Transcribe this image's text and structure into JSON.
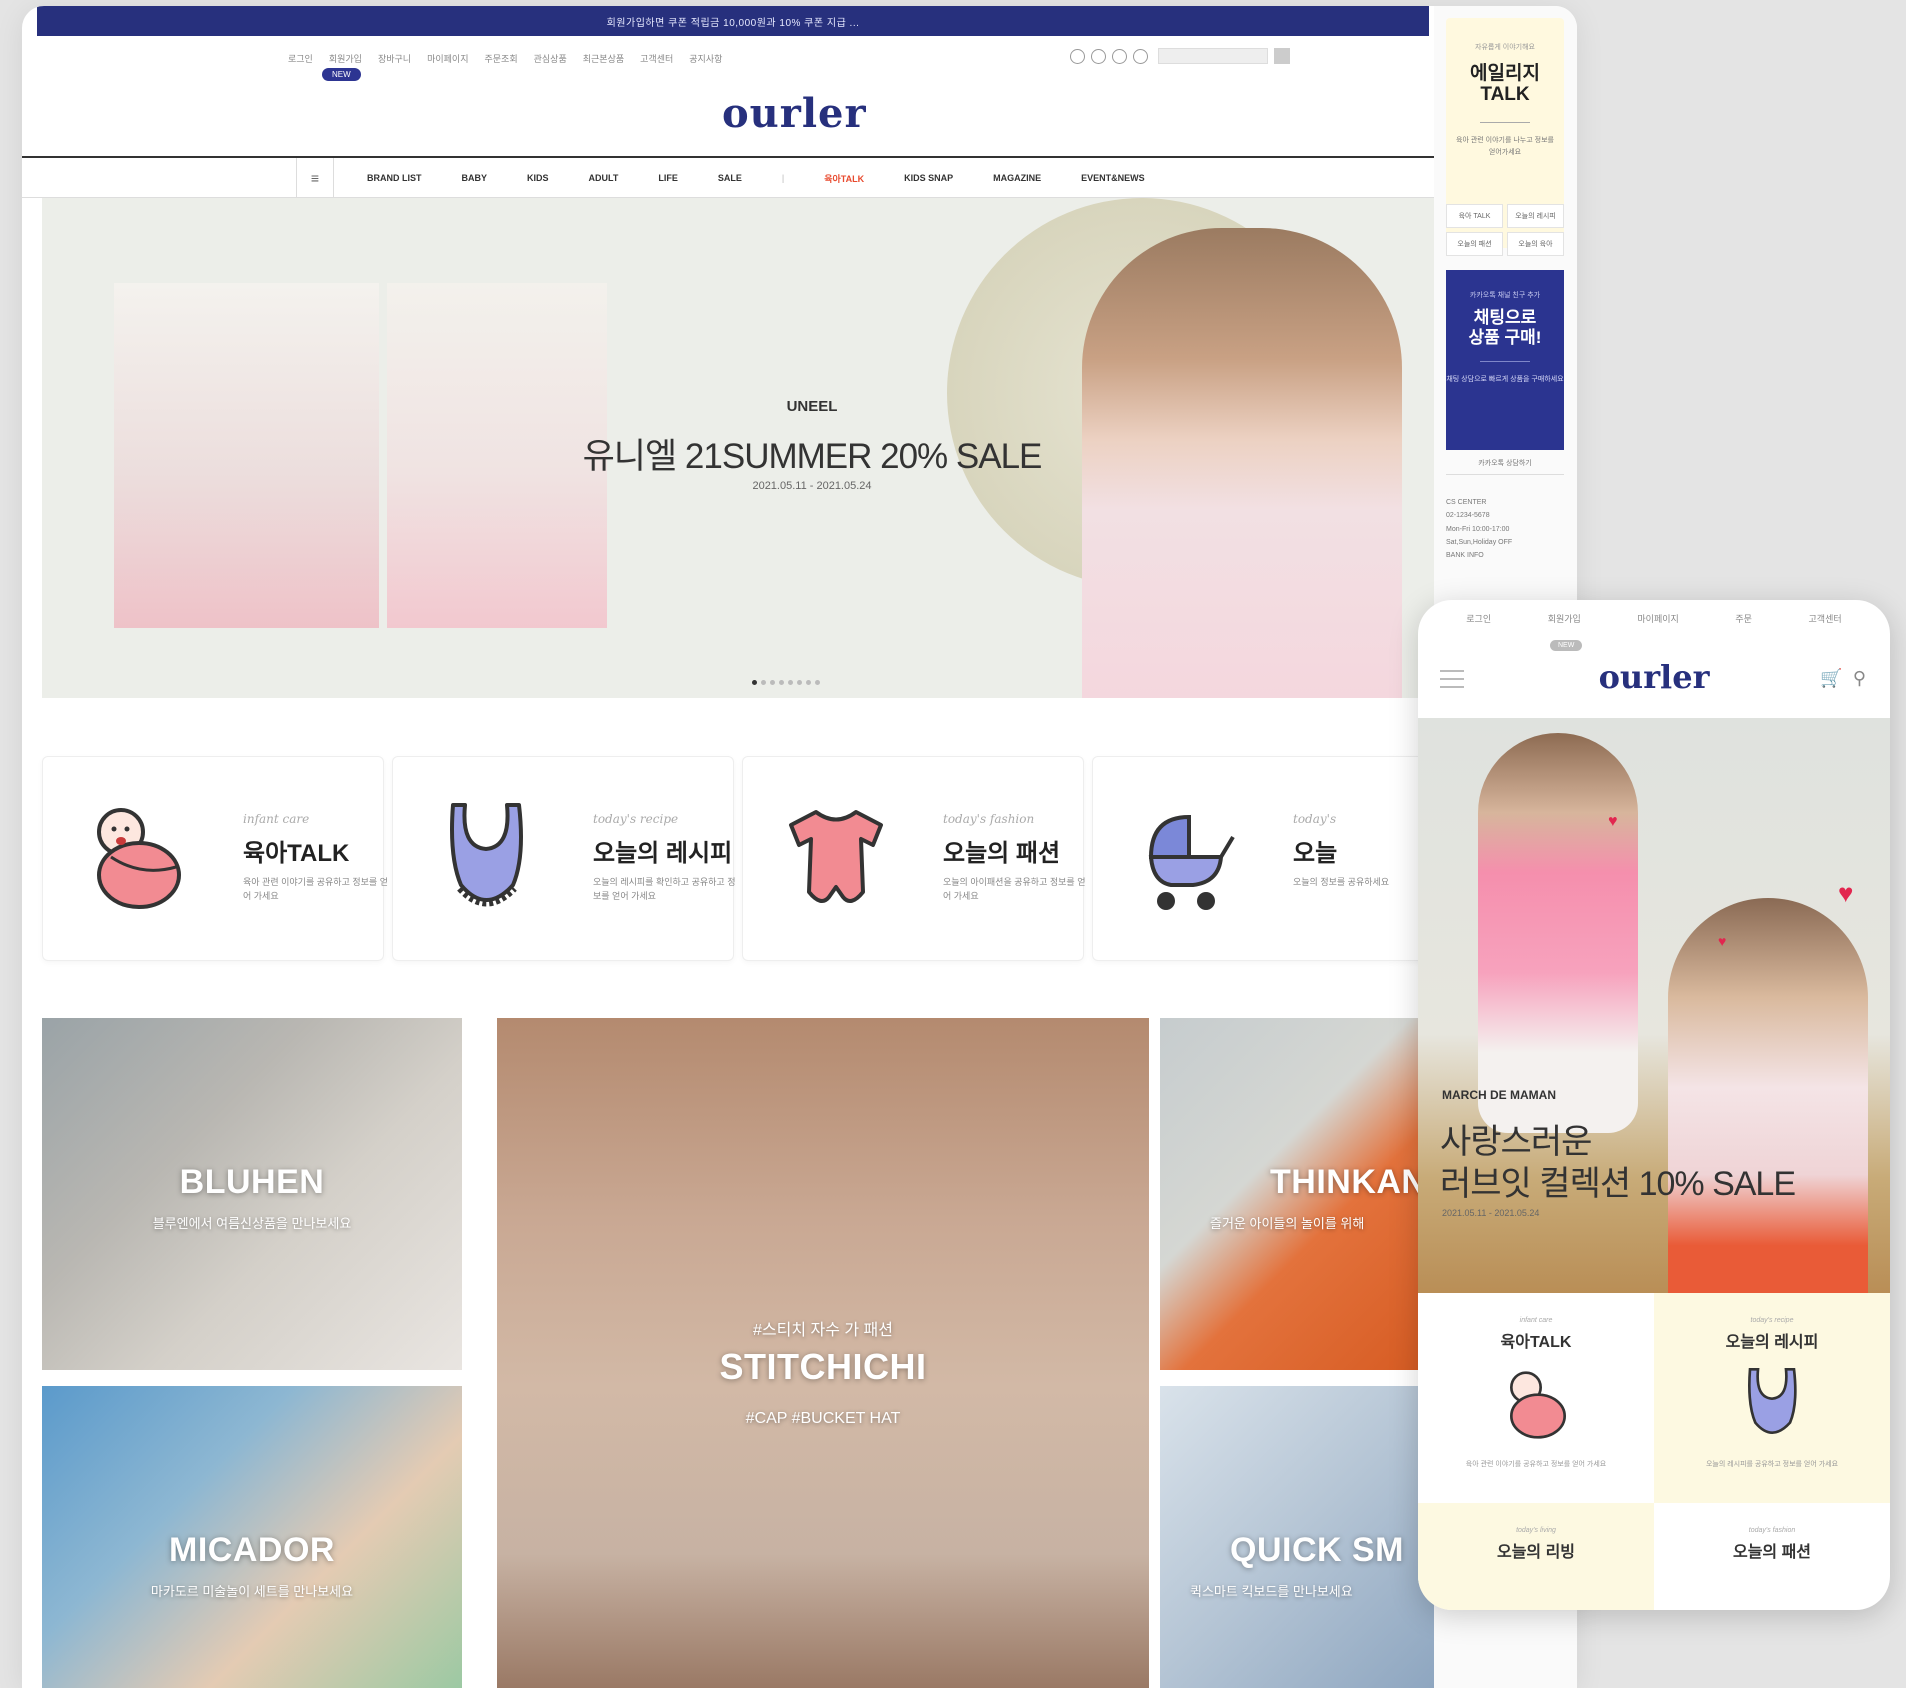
{
  "desktop": {
    "top_banner": "회원가입하면 쿠폰 적립금 10,000원과 10% 쿠폰 지급 ...",
    "util_links": [
      "로그인",
      "회원가입",
      "장바구니",
      "마이페이지",
      "주문조회",
      "관심상품",
      "최근본상품",
      "고객센터",
      "공지사항"
    ],
    "new_pill": "NEW",
    "logo": "ourler",
    "menu_icon": "≡",
    "gnb": [
      "BRAND LIST",
      "BABY",
      "KIDS",
      "ADULT",
      "LIFE",
      "SALE",
      "|",
      "육아TALK",
      "KIDS SNAP",
      "MAGAZINE",
      "EVENT&NEWS"
    ],
    "hero": {
      "brand": "UNEEL",
      "title": "유니엘 21SUMMER 20% SALE",
      "date": "2021.05.11 - 2021.05.24"
    },
    "categories": [
      {
        "sub": "infant care",
        "title": "육아TALK",
        "desc": "육아 관련 이야기를 공유하고 정보를 얻어 가세요",
        "icon": "baby-icon"
      },
      {
        "sub": "today's recipe",
        "title": "오늘의 레시피",
        "desc": "오늘의 레시피를 확인하고 공유하고 정보를 얻어 가세요",
        "icon": "bib-icon"
      },
      {
        "sub": "today's fashion",
        "title": "오늘의 패션",
        "desc": "오늘의 아이패션을 공유하고 정보를 얻어 가세요",
        "icon": "onesie-icon"
      },
      {
        "sub": "today's",
        "title": "오늘",
        "desc": "오늘의 정보를 공유하세요",
        "icon": "stroller-icon"
      }
    ],
    "brands": {
      "bluhen": {
        "name": "BLUHEN",
        "sub": "블루엔에서 여름신상품을 만나보세요"
      },
      "stitchichi": {
        "pre": "#스티치 자수 가 패션",
        "name": "STITCHICHI",
        "sub": "#CAP #BUCKET HAT"
      },
      "thinkan": {
        "name": "THINKAN",
        "sub": "즐거운 아이들의 놀이를 위해"
      },
      "micador": {
        "name": "MICADOR",
        "sub": "마카도르 미술놀이 세트를 만나보세요"
      },
      "quick": {
        "name": "QUICK SM",
        "sub": "퀵스마트 킥보드를 만나보세요"
      }
    }
  },
  "sidebar": {
    "talk": {
      "small": "자유롭게 이야기해요",
      "big1": "에일리지",
      "big2": "TALK",
      "txt": "육아 관련 이야기를 나누고 정보를 얻어가세요"
    },
    "grid": [
      "육아 TALK",
      "오늘의 레시피",
      "오늘의 패션",
      "오늘의 육아"
    ],
    "blue": {
      "small": "카카오톡 채널 친구 추가",
      "big1": "채팅으로",
      "big2": "상품 구매!",
      "txt": "채팅 상담으로 빠르게 상품을 구매하세요"
    },
    "note": "카카오톡 상담하기",
    "info": [
      "CS CENTER",
      "02-1234-5678",
      "Mon-Fri 10:00-17:00",
      "Sat,Sun,Holiday OFF",
      "BANK INFO"
    ]
  },
  "mobile": {
    "util": [
      "로그인",
      "회원가입",
      "마이페이지",
      "주문",
      "고객센터"
    ],
    "pill": "NEW",
    "logo": "ourler",
    "hero": {
      "brand": "MARCH DE MAMAN",
      "title1": "사랑스러운",
      "title2": "러브잇 컬렉션 10% SALE",
      "date": "2021.05.11 - 2021.05.24"
    },
    "cats": [
      {
        "sub": "infant care",
        "title": "육아TALK",
        "desc": "육아 관련 이야기를 공유하고 정보를 얻어 가세요"
      },
      {
        "sub": "today's recipe",
        "title": "오늘의 레시피",
        "desc": "오늘의 레시피를 공유하고 정보를 얻어 가세요"
      },
      {
        "sub": "today's living",
        "title": "오늘의 리빙",
        "desc": ""
      },
      {
        "sub": "today's fashion",
        "title": "오늘의 패션",
        "desc": ""
      }
    ]
  },
  "colors": {
    "brand_navy": "#27307d",
    "accent_red": "#e84a2e",
    "talk_yellow": "#fff9df"
  }
}
